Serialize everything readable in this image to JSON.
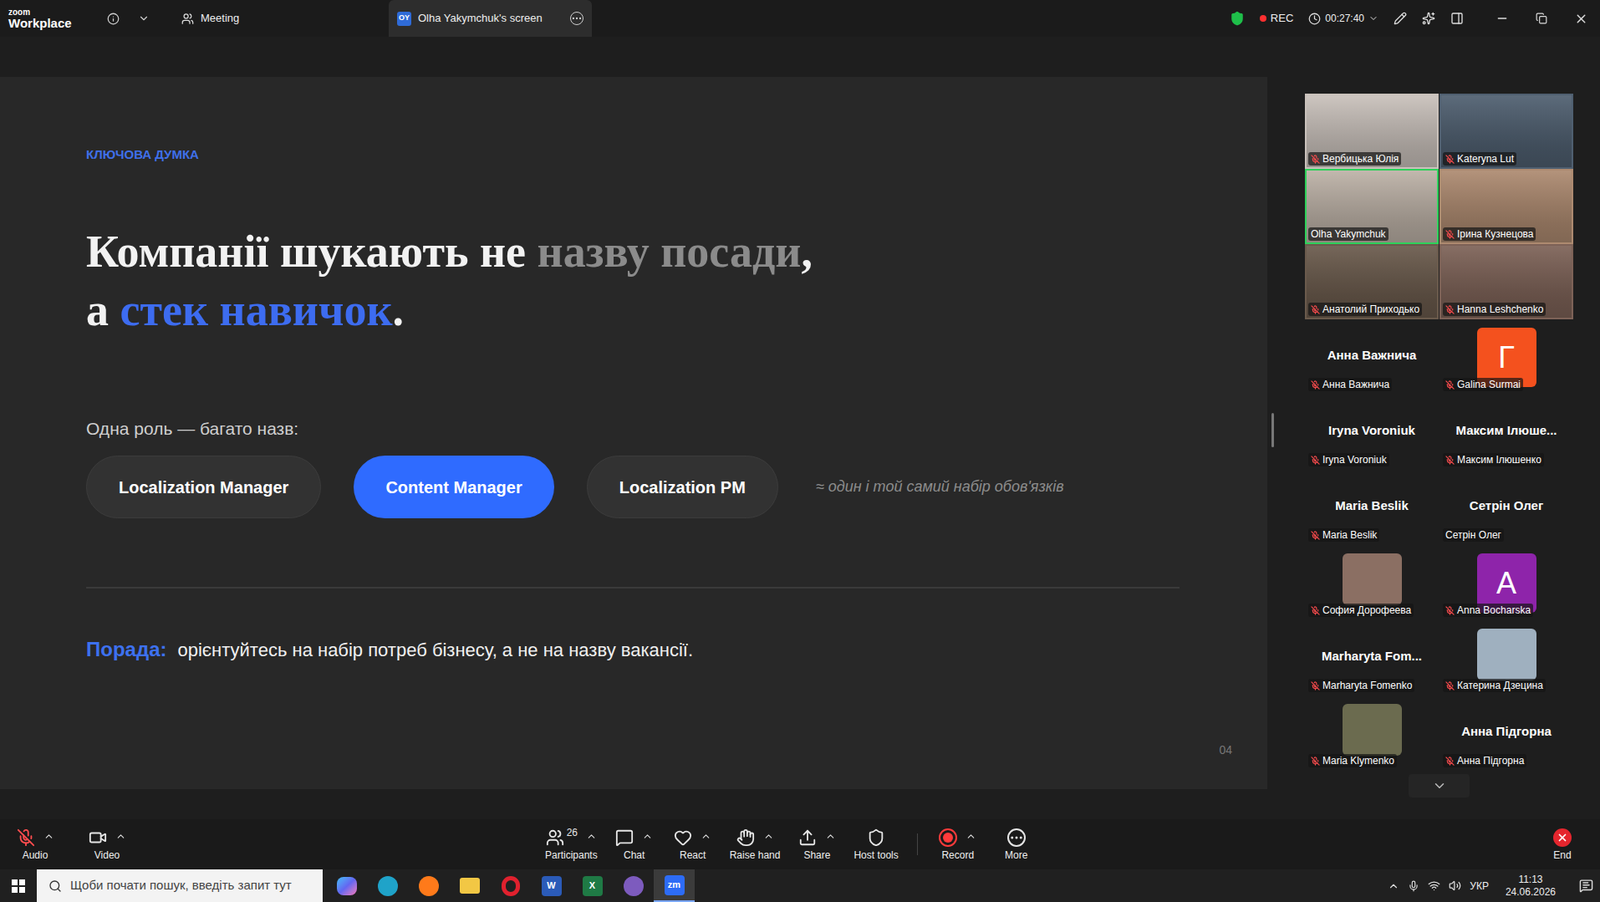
{
  "window": {
    "brand_top": "zoom",
    "brand": "Workplace"
  },
  "tabs": [
    {
      "label": "Meeting",
      "selected": false
    },
    {
      "label": "Olha Yakymchuk's screen",
      "badge": "OY",
      "selected": true
    }
  ],
  "status": {
    "recording": "REC",
    "timer": "00:27:40"
  },
  "slide": {
    "eyebrow": "КЛЮЧОВА ДУМКА",
    "headline": [
      [
        {
          "text": "Компанії шукають не ",
          "color": "#f2f2f2"
        },
        {
          "text": "назву посади",
          "color": "#8b8b8b"
        },
        {
          "text": ",",
          "color": "#f2f2f2"
        }
      ],
      [
        {
          "text": "а ",
          "color": "#f2f2f2"
        },
        {
          "text": "стек навичок",
          "color": "#3d6cf0"
        },
        {
          "text": ".",
          "color": "#f2f2f2"
        }
      ]
    ],
    "roles_title": "Одна роль — багато назв:",
    "roles": [
      {
        "label": "Localization Manager",
        "selected": false
      },
      {
        "label": "Content Manager",
        "selected": true
      },
      {
        "label": "Localization PM",
        "selected": false
      }
    ],
    "roles_note": "≈ один і той самий набір обов'язків",
    "tip_label": "Порада:",
    "tip": "орієнтуйтесь на набір потреб бізнесу, а не на назву вакансії.",
    "page": "04"
  },
  "participants": [
    {
      "name": "Вербицька Юлія",
      "kind": "video",
      "muted": true,
      "speaking": false,
      "color": "#c9c1bb"
    },
    {
      "name": "Kateryna Lut",
      "kind": "video",
      "muted": true,
      "speaking": false,
      "color": "#4f5f70"
    },
    {
      "name": "Olha Yakymchuk",
      "kind": "video",
      "muted": false,
      "speaking": true,
      "color": "#bdb2a7"
    },
    {
      "name": "Ірина Кузнецова",
      "kind": "video",
      "muted": true,
      "speaking": false,
      "color": "#ad8a70"
    },
    {
      "name": "Анатолий Приходько",
      "kind": "video",
      "muted": true,
      "speaking": false,
      "color": "#6a5a4c"
    },
    {
      "name": "Hanna Leshchenko",
      "kind": "video",
      "muted": true,
      "speaking": false,
      "color": "#7d6257"
    },
    {
      "name": "Анна Важнича",
      "display": "Анна Важнича",
      "kind": "name",
      "muted": true,
      "speaking": false
    },
    {
      "name": "Galina Surmai",
      "initial": "Г",
      "kind": "avatar",
      "muted": true,
      "speaking": false,
      "color": "#f4511e"
    },
    {
      "name": "Iryna Voroniuk",
      "display": "Iryna Voroniuk",
      "kind": "name",
      "muted": true,
      "speaking": false
    },
    {
      "name": "Максим Ілюшенко",
      "display": "Максим Ілюше...",
      "kind": "name",
      "muted": true,
      "speaking": false
    },
    {
      "name": "Maria Beslik",
      "display": "Maria Beslik",
      "kind": "name",
      "muted": true,
      "speaking": false
    },
    {
      "name": "Сетрін Олег",
      "display": "Сетрін Олег",
      "kind": "name",
      "muted": false,
      "speaking": false
    },
    {
      "name": "София Дорофеева",
      "kind": "photo",
      "muted": true,
      "speaking": false,
      "color": "#8b6f63"
    },
    {
      "name": "Anna Bocharska",
      "initial": "A",
      "kind": "avatar",
      "muted": true,
      "speaking": false,
      "color": "#8e24aa"
    },
    {
      "name": "Marharyta Fomenko",
      "display": "Marharyta Fom...",
      "kind": "name",
      "muted": true,
      "speaking": false
    },
    {
      "name": "Катерина Дзецина",
      "kind": "photo",
      "muted": true,
      "speaking": false,
      "color": "#9fb0bf"
    },
    {
      "name": "Maria Klymenko",
      "kind": "photo",
      "muted": true,
      "speaking": false,
      "color": "#6b6b4f"
    },
    {
      "name": "Анна Підгорна",
      "display": "Анна Підгорна",
      "kind": "name",
      "muted": true,
      "speaking": false
    }
  ],
  "toolbar": {
    "left": [
      {
        "label": "Audio",
        "muted": true,
        "menu": true
      },
      {
        "label": "Video",
        "menu": true
      }
    ],
    "center": [
      {
        "label": "Participants",
        "count": "26",
        "menu": true
      },
      {
        "label": "Chat",
        "menu": true
      },
      {
        "label": "React",
        "menu": true
      },
      {
        "label": "Raise hand",
        "menu": true
      },
      {
        "label": "Share",
        "menu": true
      },
      {
        "label": "Host tools",
        "menu": false
      },
      {
        "label": "Record",
        "menu": true,
        "recording": true
      },
      {
        "label": "More",
        "menu": false
      }
    ],
    "end": {
      "label": "End"
    }
  },
  "taskbar": {
    "search_placeholder": "Щоби почати пошук, введіть запит тут",
    "apps": [
      {
        "kind": "copilot",
        "color": "#3b82f6",
        "selected": false
      },
      {
        "kind": "circle",
        "color": "#1fa3c9",
        "selected": false
      },
      {
        "kind": "circle",
        "color": "#ff7a1a",
        "selected": false
      },
      {
        "kind": "folder",
        "color": "#f2c744",
        "selected": false
      },
      {
        "kind": "ring",
        "color": "#e0212e",
        "selected": false
      },
      {
        "kind": "tile",
        "glyph": "W",
        "color": "#2b5bb8",
        "selected": false
      },
      {
        "kind": "tile",
        "glyph": "X",
        "color": "#1f7a45",
        "selected": false
      },
      {
        "kind": "circle",
        "color": "#7d5bbe",
        "selected": false
      },
      {
        "kind": "tile",
        "glyph": "zm",
        "color": "#2d6cf6",
        "selected": true
      }
    ],
    "language": "УКР",
    "time": "11:13",
    "date": "24.06.2026"
  }
}
